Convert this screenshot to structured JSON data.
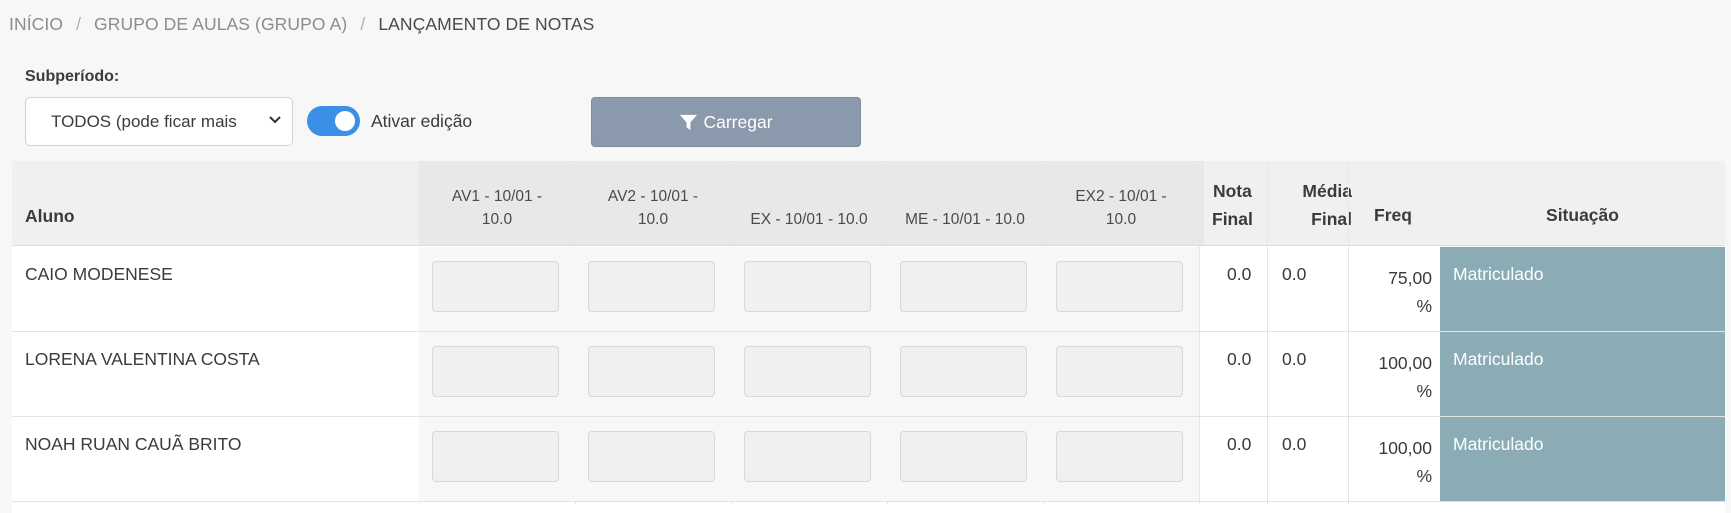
{
  "breadcrumb": {
    "items": [
      "INÍCIO",
      "GRUPO DE AULAS (GRUPO A)",
      "LANÇAMENTO DE NOTAS"
    ],
    "separator": "/"
  },
  "filters": {
    "subperiod_label": "Subperíodo:",
    "subperiod_value": "TODOS (pode ficar mais",
    "edit_toggle_label": "Ativar edição",
    "edit_toggle_on": true,
    "load_button_label": "Carregar"
  },
  "table": {
    "headers": {
      "student": "Aluno",
      "av1": [
        "AV1 - 10/01 -",
        "10.0"
      ],
      "av2": [
        "AV2 - 10/01 -",
        "10.0"
      ],
      "ex": "EX - 10/01 - 10.0",
      "me": "ME - 10/01 - 10.0",
      "ex2": [
        "EX2 - 10/01 -",
        "10.0"
      ],
      "final_grade": [
        "Nota",
        "Final"
      ],
      "final_avg": [
        "Média",
        "Final"
      ],
      "freq": "Freq",
      "status": "Situação"
    },
    "rows": [
      {
        "name": "CAIO MODENESE",
        "final_grade": "0.0",
        "final_avg": "0.0",
        "freq": [
          "75,00",
          "%"
        ],
        "status": "Matriculado"
      },
      {
        "name": "LORENA VALENTINA COSTA",
        "final_grade": "0.0",
        "final_avg": "0.0",
        "freq": [
          "100,00",
          "%"
        ],
        "status": "Matriculado"
      },
      {
        "name": "NOAH RUAN CAUÃ BRITO",
        "final_grade": "0.0",
        "final_avg": "0.0",
        "freq": [
          "100,00",
          "%"
        ],
        "status": "Matriculado"
      }
    ]
  },
  "colors": {
    "status_bg": "#8babb5",
    "toggle_on": "#3b8fe6",
    "load_button": "#8a99ac"
  }
}
